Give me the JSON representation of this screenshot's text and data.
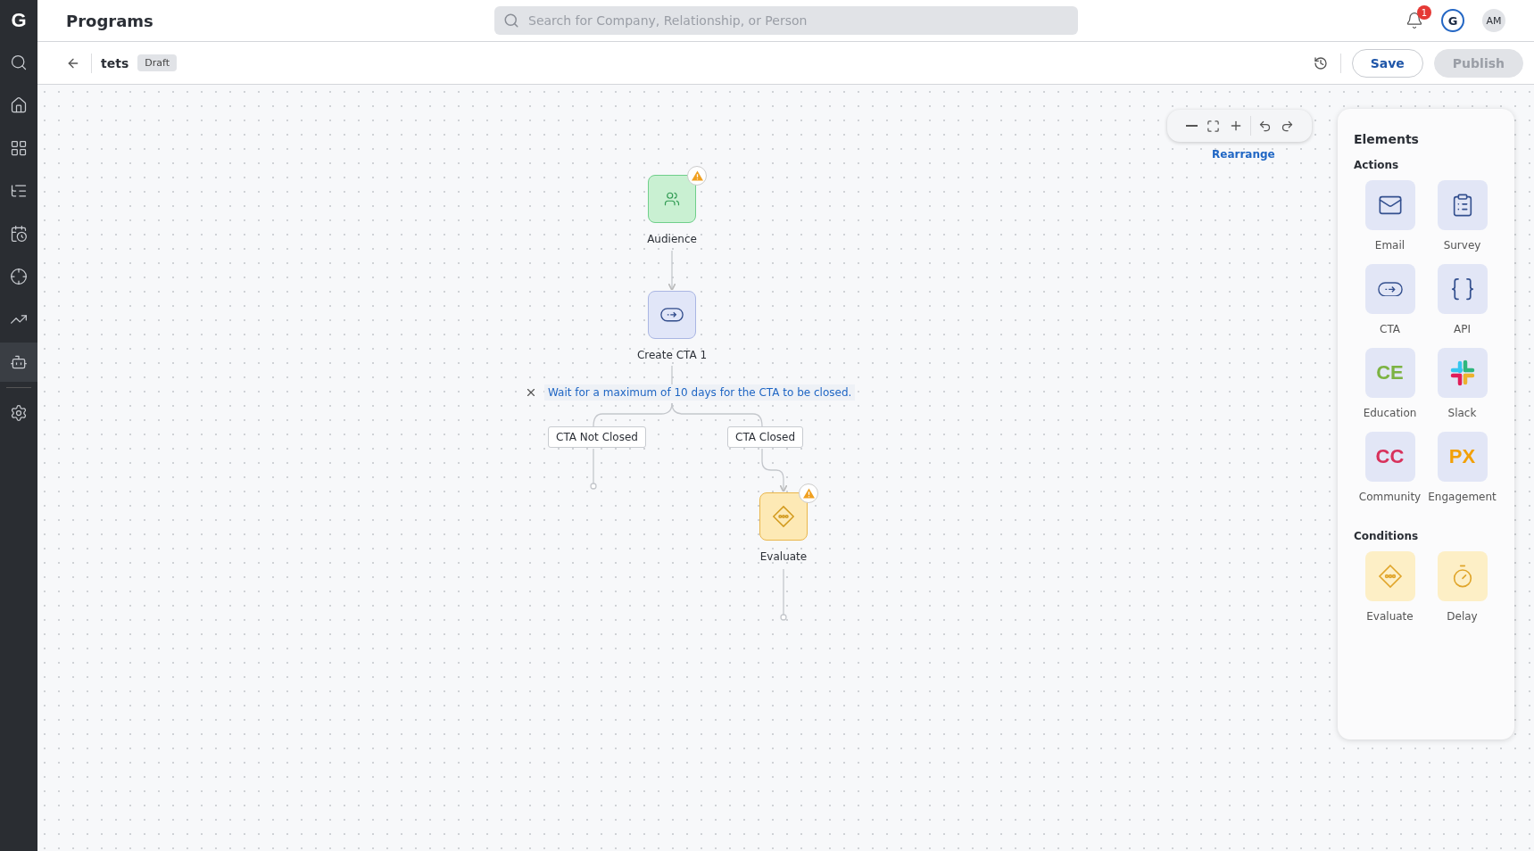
{
  "sidebar": {
    "logo": "G",
    "items": [
      {
        "selected": false
      },
      {
        "selected": false
      },
      {
        "selected": false
      },
      {
        "selected": false
      },
      {
        "selected": false
      },
      {
        "selected": false
      },
      {
        "selected": false
      },
      {
        "selected": true
      },
      {
        "selected": false
      }
    ]
  },
  "header": {
    "title": "Programs",
    "search": {
      "placeholder": "Search for Company, Relationship, or Person"
    },
    "notification_count": "1",
    "brand_avatar": "G",
    "user_initials": "AM"
  },
  "program": {
    "name": "tets",
    "status": "Draft",
    "buttons": [
      {
        "label": "Save",
        "disabled": false
      },
      {
        "label": "Publish",
        "disabled": true
      }
    ]
  },
  "canvas": {
    "nodes": [
      {
        "kind": "audience",
        "label": "Audience",
        "warning": true
      },
      {
        "kind": "cta",
        "label": "Create CTA 1",
        "warning": false
      },
      {
        "kind": "evaluate",
        "label": "Evaluate",
        "warning": true
      }
    ],
    "wait_note": "Wait for a maximum of 10 days for the CTA to be closed.",
    "branches": [
      "CTA Not Closed",
      "CTA Closed"
    ],
    "rearrange": "Rearrange"
  },
  "elements": {
    "title": "Elements",
    "sections": [
      {
        "title": "Actions",
        "kind": "action",
        "items": [
          {
            "kind": "email",
            "label": "Email"
          },
          {
            "kind": "survey",
            "label": "Survey"
          },
          {
            "kind": "cta",
            "label": "CTA"
          },
          {
            "kind": "api",
            "label": "API"
          },
          {
            "kind": "text",
            "badge": "CE",
            "color": "#7cb342",
            "label": "Education"
          },
          {
            "kind": "slack",
            "label": "Slack"
          },
          {
            "kind": "text",
            "badge": "CC",
            "color": "#d8315b",
            "label": "Community"
          },
          {
            "kind": "text",
            "badge": "PX",
            "color": "#f2a007",
            "label": "Engagement"
          }
        ]
      },
      {
        "title": "Conditions",
        "kind": "condition",
        "items": [
          {
            "kind": "evaluate",
            "label": "Evaluate"
          },
          {
            "kind": "delay",
            "label": "Delay"
          }
        ]
      }
    ]
  }
}
